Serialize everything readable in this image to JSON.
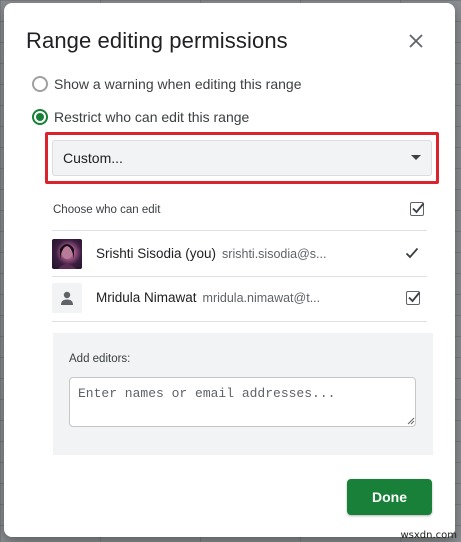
{
  "dialog": {
    "title": "Range editing permissions",
    "close_icon": "close-icon"
  },
  "options": [
    {
      "label": "Show a warning when editing this range",
      "selected": false
    },
    {
      "label": "Restrict who can edit this range",
      "selected": true
    }
  ],
  "restrict_select": {
    "value": "Custom...",
    "icon": "chevron-down-icon"
  },
  "choose": {
    "label": "Choose who can edit",
    "all_checked": true
  },
  "users": [
    {
      "name": "Srishti Sisodia (you)",
      "email": "srishti.sisodia@s...",
      "avatar": "profile-photo",
      "checked": true,
      "check_style": "plain-check"
    },
    {
      "name": "Mridula Nimawat",
      "email": "mridula.nimawat@t...",
      "avatar": "person-icon",
      "checked": true,
      "check_style": "checkbox"
    }
  ],
  "add_editors": {
    "label": "Add editors:",
    "placeholder": "Enter names or email addresses...",
    "value": ""
  },
  "done_label": "Done",
  "colors": {
    "accent": "#188038",
    "highlight": "#d9232d"
  },
  "watermark": "wsxdn.com"
}
